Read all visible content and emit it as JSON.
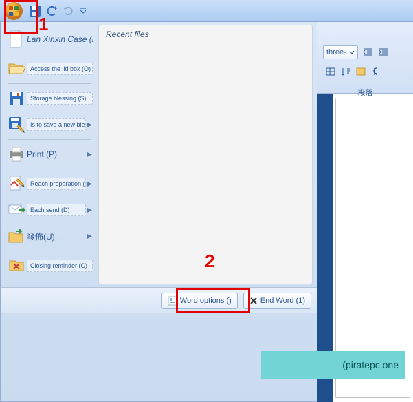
{
  "qat": {
    "office": "Office",
    "save": "save-icon",
    "undo": "undo-icon",
    "redo": "redo-icon"
  },
  "annotations": {
    "one": "1",
    "two": "2",
    "watermark": "(piratepc.one"
  },
  "menu": {
    "items": [
      {
        "icon": "new-doc-icon",
        "label": "Lan Xinxin Case (N)",
        "style": "big",
        "arrow": false
      },
      {
        "icon": "open-folder-icon",
        "label": "Access the lid box (O)",
        "style": "boxed",
        "arrow": false
      },
      {
        "icon": "save-disk-icon",
        "label": "Storage blessing (S)",
        "style": "boxed",
        "arrow": false
      },
      {
        "icon": "saveas-disk-icon",
        "label": "Is to save a new blessing (A)",
        "style": "boxed",
        "arrow": true
      },
      {
        "icon": "print-icon",
        "label": "Print (P)",
        "style": "big",
        "arrow": true
      },
      {
        "icon": "prepare-icon",
        "label": "Reach preparation (E)",
        "style": "boxed",
        "arrow": true
      },
      {
        "icon": "send-icon",
        "label": "Each send (D)",
        "style": "boxed",
        "arrow": true
      },
      {
        "icon": "publish-icon",
        "label": "發佈(U)",
        "style": "big",
        "arrow": true
      },
      {
        "icon": "close-icon",
        "label": "Closing reminder (C)",
        "style": "boxed",
        "arrow": false
      }
    ],
    "recent_title": "Recent files",
    "bottom": {
      "options": "Word options ()",
      "exit": "End Word (1)"
    }
  },
  "ribbon": {
    "dropdown": "three-",
    "group": "段落"
  }
}
